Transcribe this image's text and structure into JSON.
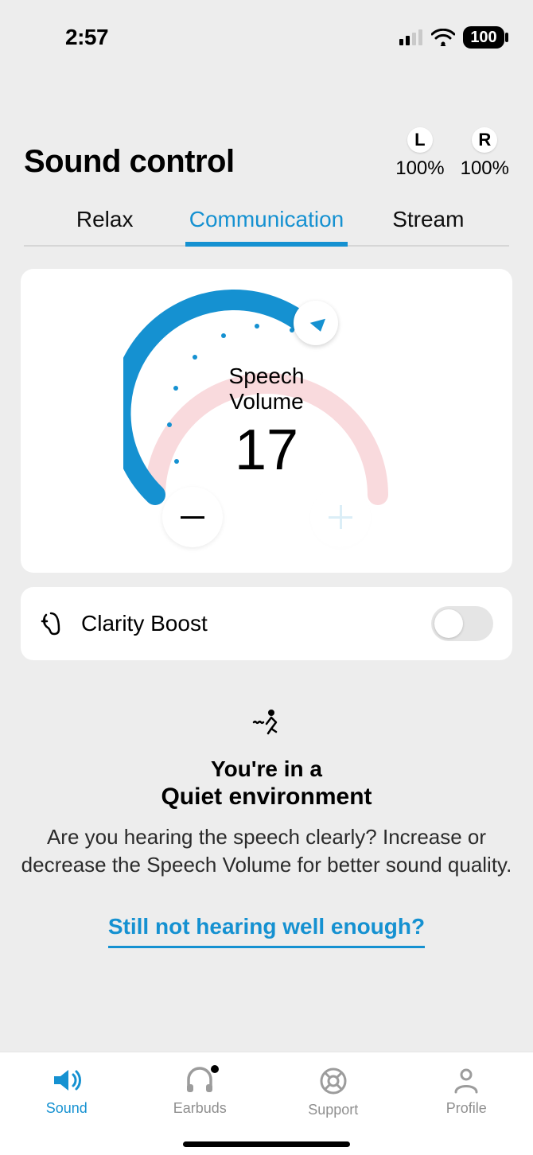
{
  "statusbar": {
    "time": "2:57",
    "battery": "100"
  },
  "header": {
    "title": "Sound control",
    "left": {
      "label": "L",
      "value": "100%"
    },
    "right": {
      "label": "R",
      "value": "100%"
    }
  },
  "tabs": {
    "relax": "Relax",
    "communication": "Communication",
    "stream": "Stream",
    "active": "communication"
  },
  "gauge": {
    "label_line1": "Speech",
    "label_line2": "Volume",
    "value": "17"
  },
  "clarity": {
    "label": "Clarity Boost",
    "enabled": false
  },
  "environment": {
    "pre": "You're in a",
    "title": "Quiet environment",
    "desc": "Are you hearing the speech clearly? Increase or decrease the Speech Volume for better sound quality.",
    "link": "Still not hearing well enough?"
  },
  "tabbar": {
    "sound": "Sound",
    "earbuds": "Earbuds",
    "support": "Support",
    "profile": "Profile",
    "active": "sound",
    "earbuds_badge": true
  }
}
